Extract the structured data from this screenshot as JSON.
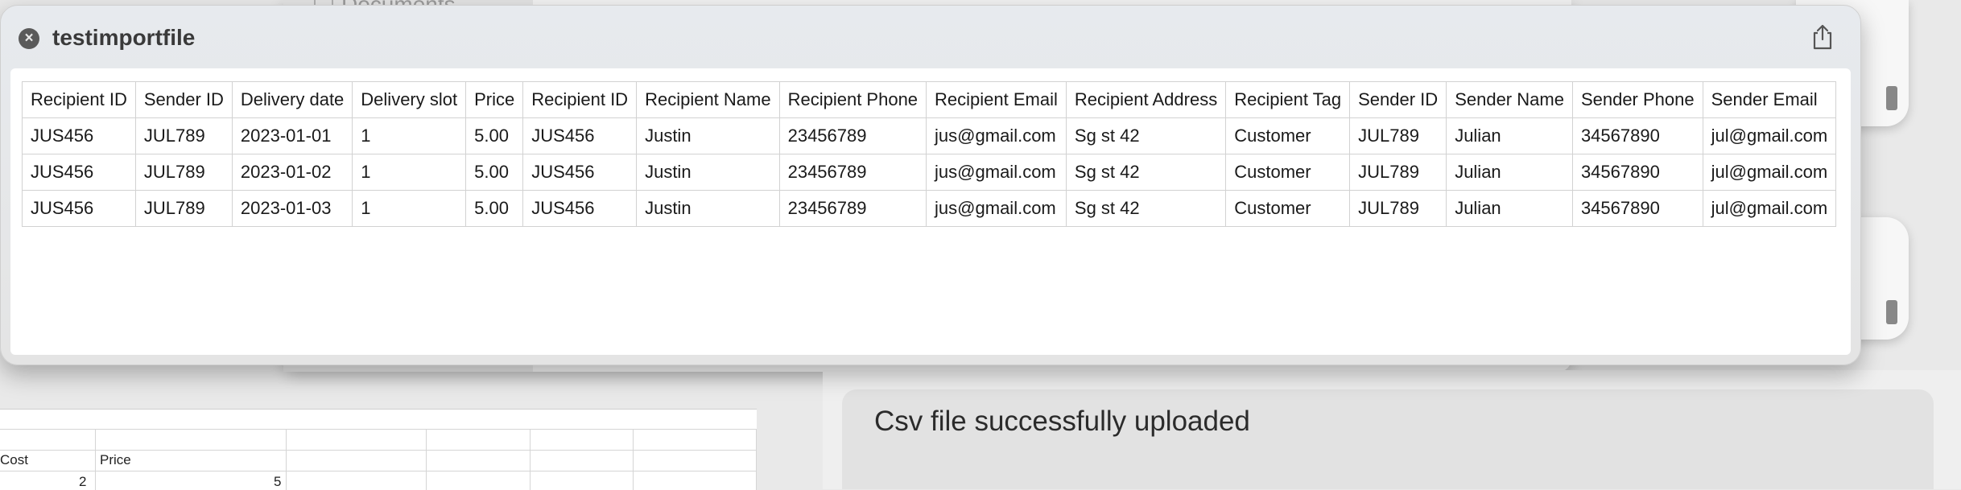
{
  "background": {
    "documents_label": "Documents",
    "spreadsheet": {
      "headers": [
        "Cost",
        "Price"
      ],
      "values": [
        "2",
        "5"
      ]
    },
    "status_message": "Csv file successfully uploaded"
  },
  "quicklook": {
    "title": "testimportfile",
    "close_icon": "close-icon",
    "share_icon": "share-icon",
    "table": {
      "headers": [
        "Recipient ID",
        "Sender ID",
        "Delivery date",
        "Delivery slot",
        "Price",
        "Recipient ID",
        "Recipient Name",
        "Recipient Phone",
        "Recipient Email",
        "Recipient Address",
        "Recipient Tag",
        "Sender ID",
        "Sender Name",
        "Sender Phone",
        "Sender Email"
      ],
      "rows": [
        [
          "JUS456",
          "JUL789",
          "2023-01-01",
          "1",
          "5.00",
          "JUS456",
          "Justin",
          "23456789",
          "jus@gmail.com",
          "Sg st 42",
          "Customer",
          "JUL789",
          "Julian",
          "34567890",
          "jul@gmail.com"
        ],
        [
          "JUS456",
          "JUL789",
          "2023-01-02",
          "1",
          "5.00",
          "JUS456",
          "Justin",
          "23456789",
          "jus@gmail.com",
          "Sg st 42",
          "Customer",
          "JUL789",
          "Julian",
          "34567890",
          "jul@gmail.com"
        ],
        [
          "JUS456",
          "JUL789",
          "2023-01-03",
          "1",
          "5.00",
          "JUS456",
          "Justin",
          "23456789",
          "jus@gmail.com",
          "Sg st 42",
          "Customer",
          "JUL789",
          "Julian",
          "34567890",
          "jul@gmail.com"
        ]
      ]
    }
  }
}
